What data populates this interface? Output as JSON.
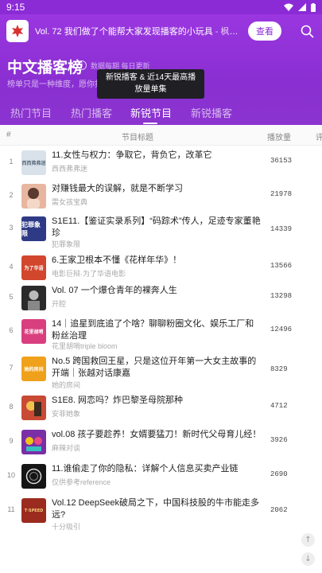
{
  "status": {
    "time": "9:15"
  },
  "promo": {
    "text": "Vol. 72 我们做了个能帮大家发现播客的小玩具",
    "source": " - 枫言枫语",
    "button": "查看"
  },
  "ranking": {
    "title": "中文播客榜",
    "update_note": "数据每期 每日更新",
    "description": "榜单只是一种维度，愿你找",
    "tooltip": "新锐播客 & 近14天最高播放量单集"
  },
  "tabs": [
    "热门节目",
    "热门播客",
    "新锐节目",
    "新锐播客"
  ],
  "active_tab": 2,
  "table": {
    "columns": [
      "#",
      "节目标题",
      "播放量",
      "评"
    ],
    "rows": [
      {
        "rank": "1",
        "title": "11.女性与权力：争取它，背负它，改革它",
        "author": "西西弗弗迷",
        "plays": "36153",
        "cover_text": "西西弗弗迷",
        "cover_color": "#d9e2ea"
      },
      {
        "rank": "2",
        "title": "对赚钱最大的误解，就是不断学习",
        "author": "需女孩宝典",
        "plays": "21978",
        "cover_text": "",
        "cover_color": "#e8b6a0"
      },
      {
        "rank": "3",
        "title": "S1E11.【鉴证实录系列】“码踪术”传人，足迹专家董艳珍",
        "author": "犯罪象限",
        "plays": "14339",
        "cover_text": "犯罪象限",
        "cover_color": "#2f3a86"
      },
      {
        "rank": "4",
        "title": "6.王家卫根本不懂《花样年华》！",
        "author": "电影巨辩·为了华语电影",
        "plays": "13566",
        "cover_text": "为了华语",
        "cover_color": "#d2462e"
      },
      {
        "rank": "5",
        "title": "Vol. 07 一个爆仓青年的裸奔人生",
        "author": "开腔",
        "plays": "13298",
        "cover_text": "",
        "cover_color": "#2b2b2b"
      },
      {
        "rank": "6",
        "title": "14｜追星到底追了个啥？聊聊粉圈文化、娱乐工厂和粉丝治理",
        "author": "花里胡哨triple bloom",
        "plays": "12496",
        "cover_text": "花里胡哨",
        "cover_color": "#d93f7f"
      },
      {
        "rank": "7",
        "title": "No.5 跨国救回王星，只是这位开年第一大女主故事的开端｜张越对话康嘉",
        "author": "她的房间",
        "plays": "8329",
        "cover_text": "她的房间",
        "cover_color": "#f0a11c"
      },
      {
        "rank": "8",
        "title": "S1E8. 网恋吗？炸巴黎圣母院那种",
        "author": "安菲她象",
        "plays": "4712",
        "cover_text": "",
        "cover_color": "#c94a34"
      },
      {
        "rank": "9",
        "title": "vol.08 孩子要趁养！女婿要猛刀！新时代父母育儿经！",
        "author": "麻辣对谈",
        "plays": "3926",
        "cover_text": "",
        "cover_color": "#7a2fa6"
      },
      {
        "rank": "10",
        "title": "11.谁偷走了你的隐私：详解个人信息买卖产业链",
        "author": "仅供参考reference",
        "plays": "2690",
        "cover_text": "",
        "cover_color": "#151515"
      },
      {
        "rank": "11",
        "title": "Vol.12 DeepSeek破局之下，中国科技股的牛市能走多远?",
        "author": "十分吸引",
        "plays": "2062",
        "cover_text": "T·SPEED",
        "cover_color": "#9c2b1f"
      }
    ]
  },
  "colors": {
    "header": "#8b2bd6",
    "accent": "#8b2bd6"
  }
}
